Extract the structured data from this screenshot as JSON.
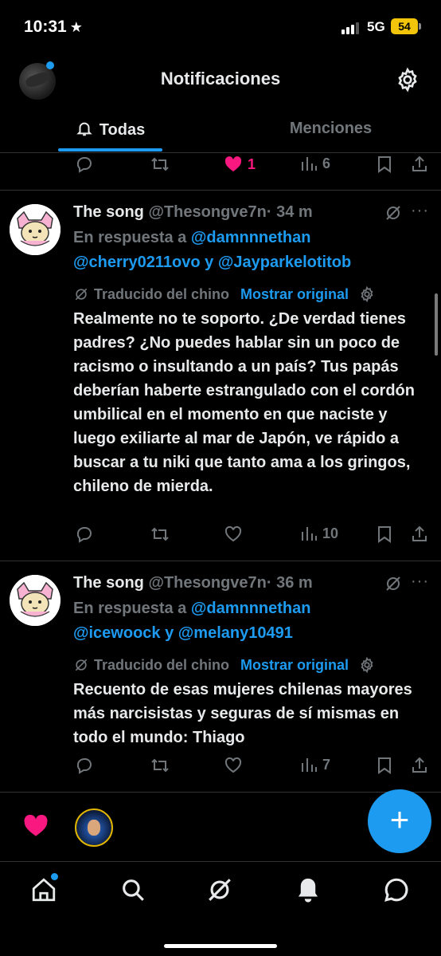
{
  "status_bar": {
    "time": "10:31",
    "time_star": "★",
    "network": "5G",
    "battery": "54"
  },
  "header": {
    "title": "Notificaciones"
  },
  "tabs": [
    {
      "label": "Todas",
      "active": true
    },
    {
      "label": "Menciones",
      "active": false
    }
  ],
  "prev_tweet_actions": {
    "likes": "1",
    "views": "6"
  },
  "tweets": [
    {
      "name": "The song",
      "handle": "@Thesongve7n",
      "time": "· 34 m",
      "reply_prefix": "En respuesta a",
      "reply_user1": "@damnnnethan",
      "reply_user2": "@cherry0211ovo",
      "reply_joiner": "y",
      "reply_user3": "@Jayparkelotitob",
      "translated_label": "Traducido del chino",
      "show_original": "Mostrar original",
      "body": "Realmente no te soporto. ¿De verdad tienes padres? ¿No puedes hablar sin un poco de racismo o insultando a un país? Tus papás deberían haberte estrangulado con el cordón umbilical en el momento en que naciste y luego exiliarte al mar de Japón, ve rápido a buscar a tu niki que tanto ama a los gringos, chileno de mierda.",
      "views": "10"
    },
    {
      "name": "The song",
      "handle": "@Thesongve7n",
      "time": "· 36 m",
      "reply_prefix": "En respuesta a",
      "reply_user1": "@damnnnethan",
      "reply_user2": "@icewoock",
      "reply_joiner": "y",
      "reply_user3": "@melany10491",
      "translated_label": "Traducido del chino",
      "show_original": "Mostrar original",
      "body": "Recuento de esas mujeres chilenas mayores más narcisistas y seguras de sí mismas en todo el mundo: Thiago",
      "views": "7"
    }
  ],
  "fab": {
    "label": "+"
  },
  "colors": {
    "accent": "#1d9bf0",
    "like": "#f91880",
    "muted": "#71767b",
    "background": "#000000"
  },
  "icons": {
    "nav": [
      "home-icon",
      "search-icon",
      "grok-icon",
      "notifications-icon",
      "messages-icon"
    ],
    "tweet_actions": [
      "reply-icon",
      "retweet-icon",
      "like-icon",
      "views-icon",
      "bookmark-icon",
      "share-icon"
    ]
  }
}
